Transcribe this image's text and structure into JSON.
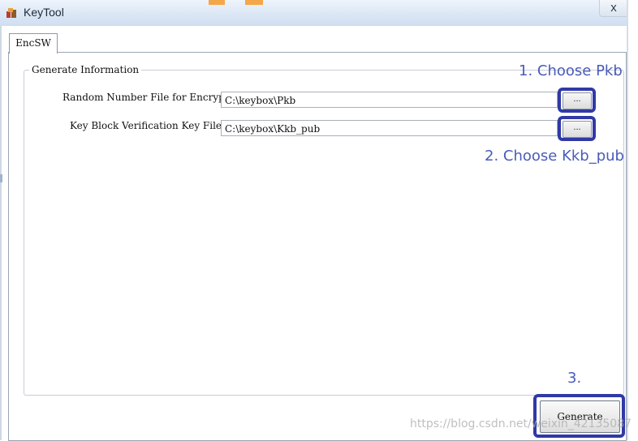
{
  "window": {
    "title": "KeyTool",
    "close_label": "x",
    "icon": "keytool-app-icon"
  },
  "tabs": [
    {
      "label": "EncSW",
      "active": true
    }
  ],
  "group": {
    "title": "Generate Information",
    "rows": [
      {
        "label": "Random Number File for Encrypt:",
        "value": "C:\\keybox\\Pkb",
        "button": "..."
      },
      {
        "label": "Key Block Verification Key File:",
        "value": "C:\\keybox\\Kkb_pub",
        "button": "..."
      }
    ]
  },
  "generate_button": "Generate",
  "annotations": {
    "step1": "1. Choose Pkb",
    "step2": "2. Choose Kkb_pub",
    "step3": "3.",
    "color": "#3039a6"
  },
  "watermark": "https://blog.csdn.net/weixin_42135087"
}
